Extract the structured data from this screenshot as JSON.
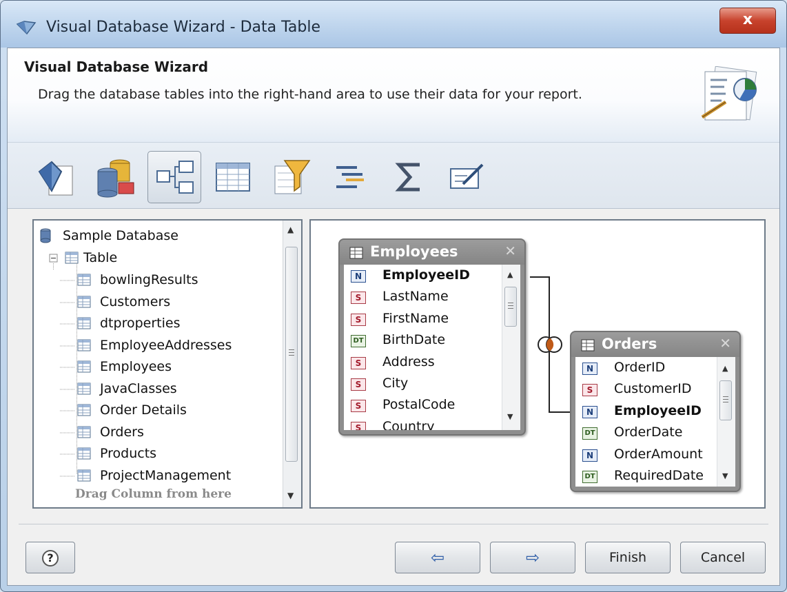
{
  "window": {
    "title": "Visual Database Wizard - Data Table",
    "close_glyph": "x"
  },
  "header": {
    "title": "Visual Database Wizard",
    "description": "Drag the database tables into the right-hand area to use their data for your report."
  },
  "toolbar": {
    "buttons": [
      {
        "icon": "report-diamond-icon"
      },
      {
        "icon": "database-connection-icon"
      },
      {
        "icon": "table-relations-icon",
        "active": true
      },
      {
        "icon": "data-grid-icon"
      },
      {
        "icon": "filter-funnel-icon"
      },
      {
        "icon": "sort-lines-icon"
      },
      {
        "icon": "sigma-sum-icon",
        "glyph": "Σ"
      },
      {
        "icon": "edit-note-icon"
      }
    ]
  },
  "tree": {
    "root": "Sample Database",
    "group": "Table",
    "items": [
      "bowlingResults",
      "Customers",
      "dtproperties",
      "EmployeeAddresses",
      "Employees",
      "JavaClasses",
      "Order Details",
      "Orders",
      "Products",
      "ProjectManagement"
    ],
    "hint": "Drag Column from here"
  },
  "tables": {
    "employees": {
      "name": "Employees",
      "columns": [
        {
          "type": "N",
          "name": "EmployeeID",
          "bold": true
        },
        {
          "type": "S",
          "name": "LastName"
        },
        {
          "type": "S",
          "name": "FirstName"
        },
        {
          "type": "DT",
          "name": "BirthDate"
        },
        {
          "type": "S",
          "name": "Address"
        },
        {
          "type": "S",
          "name": "City"
        },
        {
          "type": "S",
          "name": "PostalCode"
        },
        {
          "type": "S",
          "name": "Country"
        }
      ]
    },
    "orders": {
      "name": "Orders",
      "columns": [
        {
          "type": "N",
          "name": "OrderID"
        },
        {
          "type": "S",
          "name": "CustomerID"
        },
        {
          "type": "N",
          "name": "EmployeeID",
          "bold": true
        },
        {
          "type": "DT",
          "name": "OrderDate"
        },
        {
          "type": "N",
          "name": "OrderAmount"
        },
        {
          "type": "DT",
          "name": "RequiredDate"
        }
      ]
    }
  },
  "buttons": {
    "help": "?",
    "back": "⇦",
    "next": "⇨",
    "finish": "Finish",
    "cancel": "Cancel"
  },
  "colors": {
    "accent": "#c05a18",
    "table_header": "#8e8e8e"
  }
}
